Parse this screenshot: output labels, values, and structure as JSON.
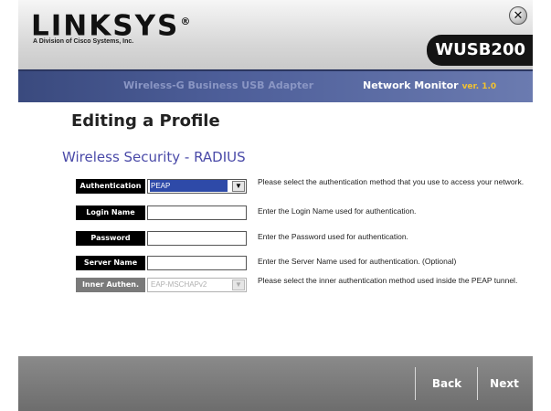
{
  "header": {
    "brand": "LINKSYS",
    "brand_mark": "®",
    "subbrand": "A Division of Cisco Systems, Inc.",
    "close_label": "✕",
    "model": "WUSB200"
  },
  "banner": {
    "product": "Wireless-G Business USB Adapter",
    "monitor": "Network Monitor",
    "version": "ver. 1.0"
  },
  "content": {
    "page_title": "Editing a Profile",
    "section_title": "Wireless Security - RADIUS",
    "rows": [
      {
        "label": "Authentication",
        "value": "PEAP",
        "placeholder": "",
        "description": "Please select the authentication method that you use to access your network."
      },
      {
        "label": "Login Name",
        "value": "",
        "placeholder": "",
        "description": "Enter the Login Name used for authentication."
      },
      {
        "label": "Password",
        "value": "",
        "placeholder": "",
        "description": "Enter the Password used for authentication."
      },
      {
        "label": "Server Name",
        "value": "",
        "placeholder": "",
        "description": "Enter the Server Name used for authentication. (Optional)"
      },
      {
        "label": "Inner Authen.",
        "value": "EAP-MSCHAPv2",
        "placeholder": "",
        "description": "Please select the inner authentication method used inside the PEAP tunnel."
      }
    ]
  },
  "footer": {
    "back_label": "Back",
    "next_label": "Next"
  },
  "icons": {
    "close": "close-icon",
    "dropdown": "chevron-down-icon"
  },
  "colors": {
    "banner": "#4d5e99",
    "section_title": "#4a4aa8",
    "version": "#f2c230",
    "label_bg": "#000000",
    "footer": "#7a7a7a"
  }
}
